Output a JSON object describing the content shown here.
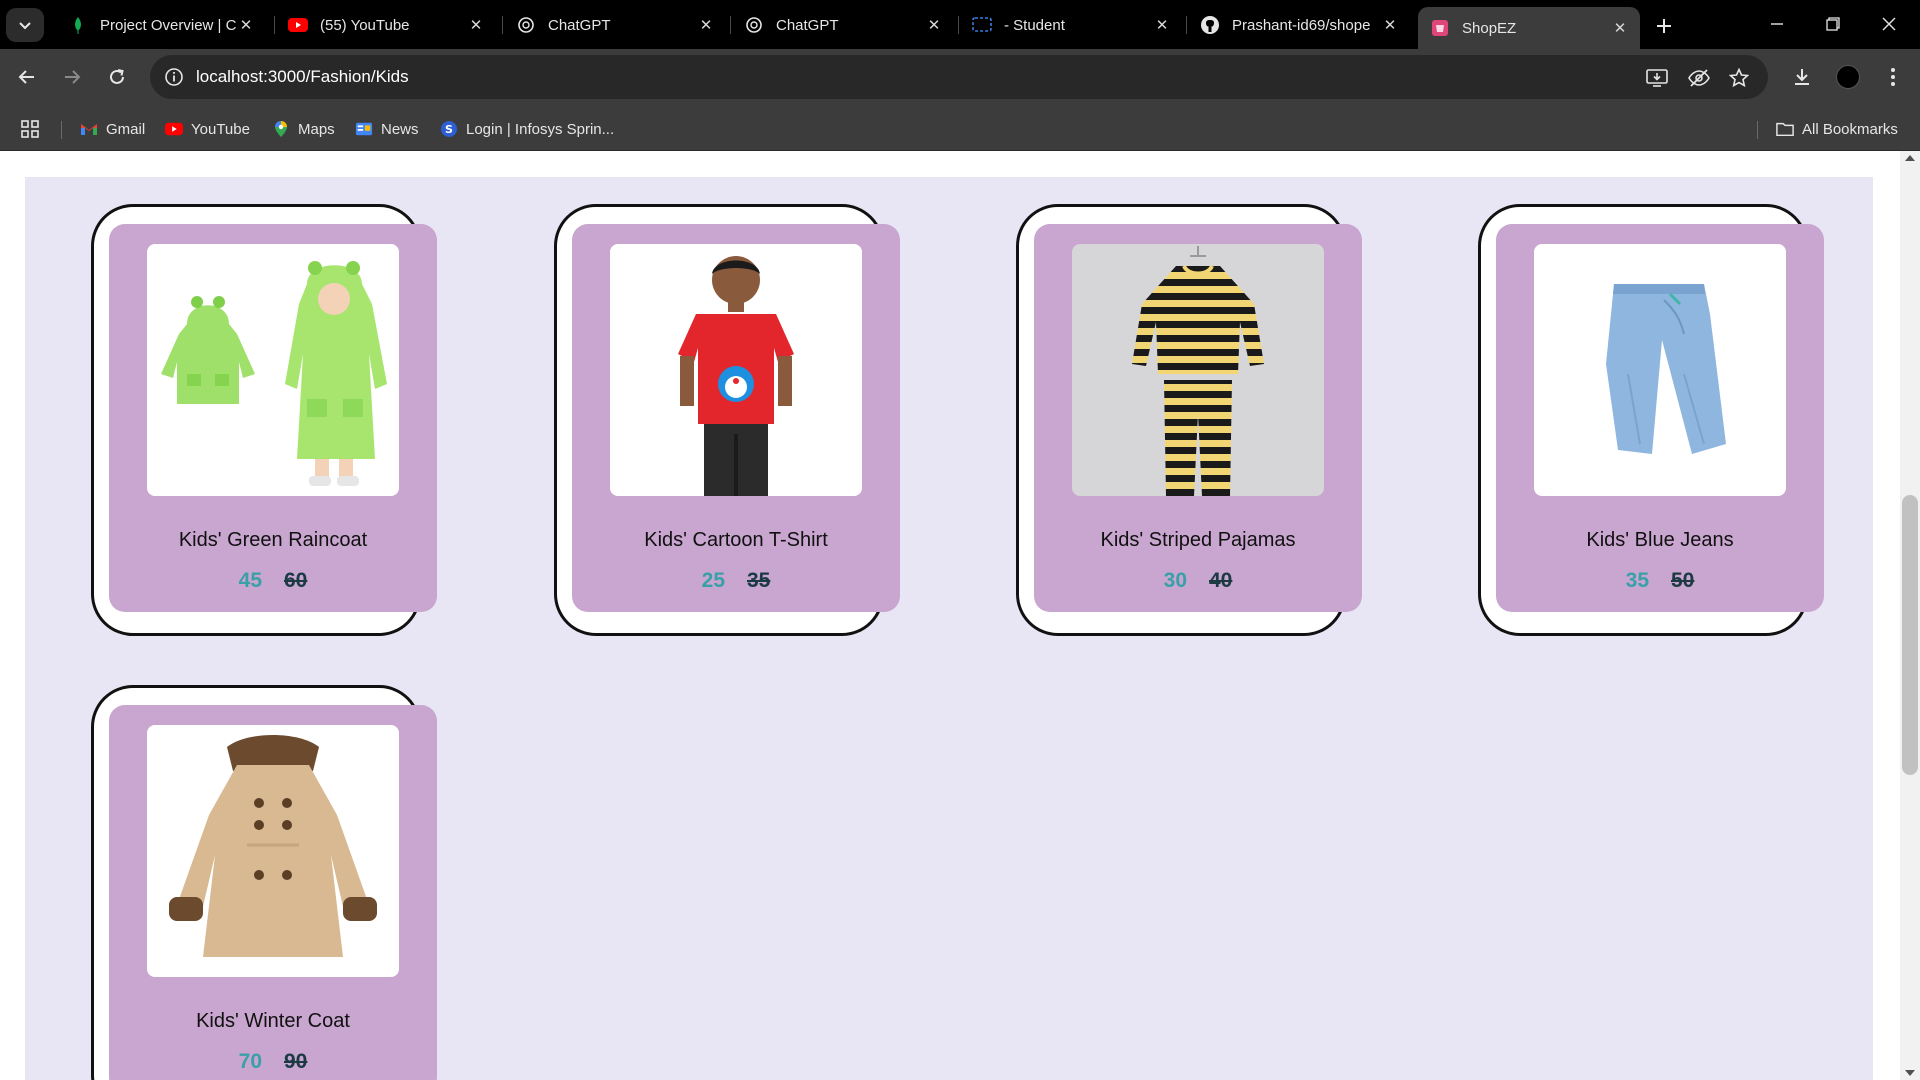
{
  "browser": {
    "tabs": [
      {
        "title": "Project Overview | Cl",
        "icon": "mongodb-leaf-icon"
      },
      {
        "title": "(55) YouTube",
        "icon": "youtube-icon"
      },
      {
        "title": "ChatGPT",
        "icon": "chatgpt-icon"
      },
      {
        "title": "ChatGPT",
        "icon": "chatgpt-icon"
      },
      {
        "title": "- Student",
        "icon": "student-portal-icon"
      },
      {
        "title": "Prashant-id69/shope",
        "icon": "github-icon"
      },
      {
        "title": "ShopEZ",
        "icon": "shopez-icon",
        "active": true
      }
    ],
    "url": "localhost:3000/Fashion/Kids",
    "bookmarks": [
      {
        "label": "Gmail",
        "icon": "gmail-icon"
      },
      {
        "label": "YouTube",
        "icon": "youtube-icon"
      },
      {
        "label": "Maps",
        "icon": "maps-icon"
      },
      {
        "label": "News",
        "icon": "news-icon"
      },
      {
        "label": "Login | Infosys Sprin...",
        "icon": "infosys-springboard-icon"
      }
    ],
    "all_bookmarks_label": "All Bookmarks"
  },
  "products": [
    {
      "name": "Kids' Green Raincoat",
      "price": "45",
      "original_price": "60",
      "image": "green-raincoat-image"
    },
    {
      "name": "Kids' Cartoon T-Shirt",
      "price": "25",
      "original_price": "35",
      "image": "red-cartoon-tshirt-image"
    },
    {
      "name": "Kids' Striped Pajamas",
      "price": "30",
      "original_price": "40",
      "image": "striped-pajamas-image"
    },
    {
      "name": "Kids' Blue Jeans",
      "price": "35",
      "original_price": "50",
      "image": "blue-jeans-image"
    },
    {
      "name": "Kids' Winter Coat",
      "price": "70",
      "original_price": "90",
      "image": "winter-coat-image"
    }
  ],
  "colors": {
    "panel_bg": "#e8e6f4",
    "card_bg": "#c8a6cf",
    "price_current": "#3aa0a8",
    "price_original": "#1c3a44"
  }
}
